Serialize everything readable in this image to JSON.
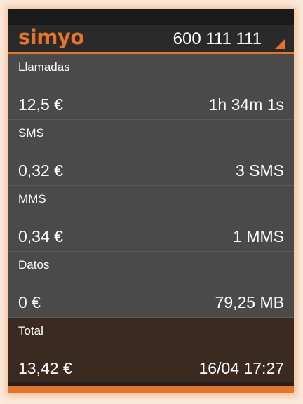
{
  "header": {
    "logo": "simyo",
    "phone_number": "600 111 111"
  },
  "rows": [
    {
      "title": "Llamadas",
      "amount": "12,5 €",
      "usage": "1h 34m 1s"
    },
    {
      "title": "SMS",
      "amount": "0,32 €",
      "usage": "3 SMS"
    },
    {
      "title": "MMS",
      "amount": "0,34 €",
      "usage": "1 MMS"
    },
    {
      "title": "Datos",
      "amount": "0 €",
      "usage": "79,25 MB"
    }
  ],
  "total": {
    "title": "Total",
    "amount": "13,42 €",
    "date": "16/04 17:27"
  },
  "colors": {
    "accent": "#e8742a",
    "row_bg": "#4a4a4a",
    "total_bg": "#3b2a1f"
  }
}
